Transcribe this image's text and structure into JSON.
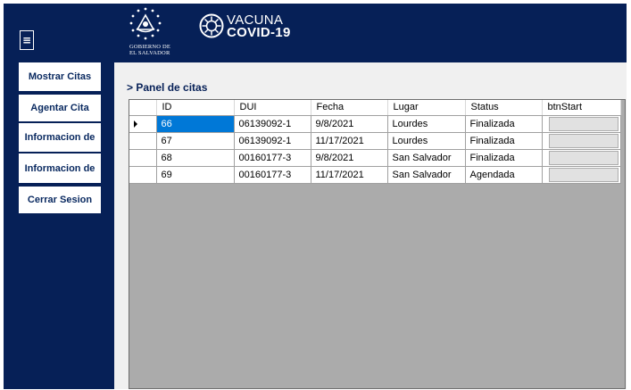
{
  "sidebar": {
    "menu_icon": "≡",
    "buttons": [
      {
        "label": "Mostrar Citas"
      },
      {
        "label": "Agentar Cita"
      },
      {
        "label": "Informacion de"
      },
      {
        "label": "Informacion de"
      },
      {
        "label": "Cerrar Sesion"
      }
    ]
  },
  "header": {
    "gov_line1": "GOBIERNO DE",
    "gov_line2": "EL SALVADOR",
    "vac_title": "VACUNA",
    "vac_subtitle": "COVID-19",
    "seal_icon": "gov-seal",
    "vaccine_icon": "virus-logo"
  },
  "panel": {
    "title": "> Panel de citas"
  },
  "table": {
    "columns": [
      "ID",
      "DUI",
      "Fecha",
      "Lugar",
      "Status",
      "btnStart"
    ],
    "rows": [
      {
        "id": "66",
        "dui": "06139092-1",
        "fecha": "9/8/2021",
        "lugar": "Lourdes",
        "status": "Finalizada"
      },
      {
        "id": "67",
        "dui": "06139092-1",
        "fecha": "11/17/2021",
        "lugar": "Lourdes",
        "status": "Finalizada"
      },
      {
        "id": "68",
        "dui": "00160177-3",
        "fecha": "9/8/2021",
        "lugar": "San Salvador",
        "status": "Finalizada"
      },
      {
        "id": "69",
        "dui": "00160177-3",
        "fecha": "11/17/2021",
        "lugar": "San Salvador",
        "status": "Agendada"
      }
    ],
    "selected_row": 0
  },
  "colors": {
    "navy": "#062057",
    "selection": "#0078d7",
    "grid_background": "#ababab"
  }
}
